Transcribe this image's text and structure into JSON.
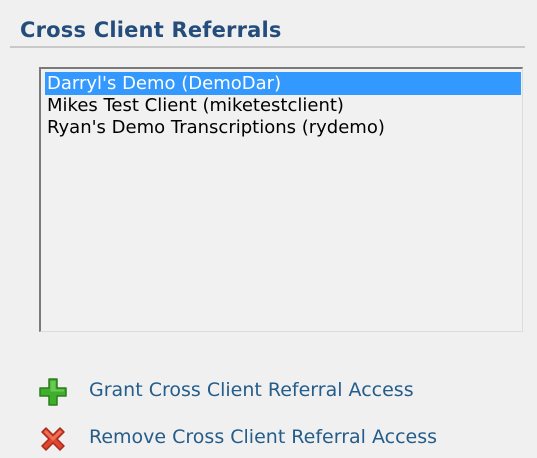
{
  "section": {
    "title": "Cross Client Referrals"
  },
  "clients": {
    "options": [
      {
        "label": "Darryl's Demo (DemoDar)",
        "selected": true
      },
      {
        "label": "Mikes Test Client (miketestclient)",
        "selected": false
      },
      {
        "label": "Ryan's Demo Transcriptions (rydemo)",
        "selected": false
      }
    ]
  },
  "actions": {
    "grant": {
      "label": "Grant Cross Client Referral Access",
      "icon": "plus-icon",
      "color": "#3fae2a"
    },
    "remove": {
      "label": "Remove Cross Client Referral Access",
      "icon": "x-icon",
      "color": "#e0462f"
    }
  },
  "colors": {
    "title": "#244d7c",
    "selection": "#3399ff",
    "link": "#245c8a"
  }
}
